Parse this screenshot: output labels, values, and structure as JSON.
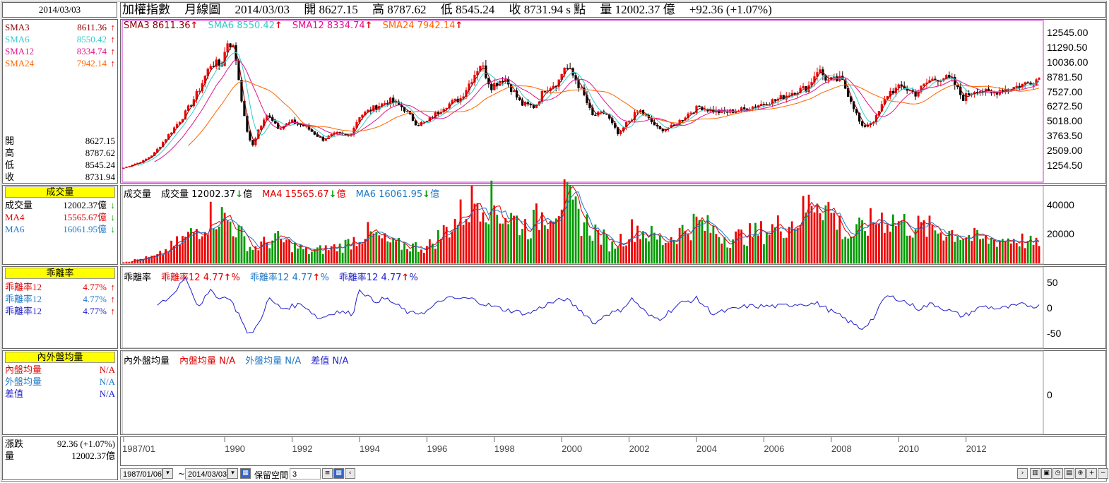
{
  "date_box": "2014/03/03",
  "header": {
    "index_name": "加權指數",
    "period": "月線圖",
    "date": "2014/03/03",
    "open": "開 8627.15",
    "high": "高 8787.62",
    "low": "低 8545.24",
    "close": "收 8731.94 s 點",
    "volume": "量 12002.37 億",
    "change": "+92.36 (+1.07%)"
  },
  "sma_panel": {
    "rows": [
      {
        "label": "SMA3",
        "value": "8611.36",
        "color": "#8b0000"
      },
      {
        "label": "SMA6",
        "value": "8550.42",
        "color": "#33cccc"
      },
      {
        "label": "SMA12",
        "value": "8334.74",
        "color": "#e0148c"
      },
      {
        "label": "SMA24",
        "value": "7942.14",
        "color": "#ff6600"
      }
    ],
    "arrow": "↑"
  },
  "ohlc_panel": {
    "rows": [
      {
        "label": "開",
        "value": "8627.15"
      },
      {
        "label": "高",
        "value": "8787.62"
      },
      {
        "label": "低",
        "value": "8545.24"
      },
      {
        "label": "收",
        "value": "8731.94"
      }
    ]
  },
  "volume_panel": {
    "title": "成交量",
    "rows": [
      {
        "label": "成交量",
        "value": "12002.37億",
        "color": "#000000",
        "arrow": "↓"
      },
      {
        "label": "MA4",
        "value": "15565.67億",
        "color": "#e00000",
        "arrow": "↓"
      },
      {
        "label": "MA6",
        "value": "16061.95億",
        "color": "#1e78c8",
        "arrow": "↓"
      }
    ]
  },
  "bias_panel": {
    "title": "乖離率",
    "rows": [
      {
        "label": "乖離率12",
        "value": "4.77%",
        "color": "#e00000",
        "arrow": "↑"
      },
      {
        "label": "乖離率12",
        "value": "4.77%",
        "color": "#1e78c8",
        "arrow": "↑"
      },
      {
        "label": "乖離率12",
        "value": "4.77%",
        "color": "#2020cc",
        "arrow": "↑"
      }
    ]
  },
  "inout_panel": {
    "title": "內外盤均量",
    "rows": [
      {
        "label": "內盤均量",
        "value": "N/A",
        "color": "#e00000"
      },
      {
        "label": "外盤均量",
        "value": "N/A",
        "color": "#1e78c8"
      },
      {
        "label": "差值",
        "value": "N/A",
        "color": "#2020cc"
      }
    ]
  },
  "change_panel": {
    "rows": [
      {
        "label": "漲跌",
        "value": "92.36 (+1.07%)"
      },
      {
        "label": "量",
        "value": "12002.37億"
      }
    ]
  },
  "legends": {
    "price": [
      {
        "text": "SMA3 8611.36",
        "color": "#8b0000"
      },
      {
        "text": "SMA6 8550.42",
        "color": "#33cccc"
      },
      {
        "text": "SMA12 8334.74",
        "color": "#e0148c"
      },
      {
        "text": "SMA24 7942.14",
        "color": "#ff6600"
      }
    ],
    "volume": [
      {
        "text": "成交量",
        "color": "#000000"
      },
      {
        "text": "成交量 12002.37",
        "color": "#000000",
        "suffix": "↓億"
      },
      {
        "text": "MA4 15565.67",
        "color": "#e00000",
        "suffix": "↓億"
      },
      {
        "text": "MA6 16061.95",
        "color": "#1e78c8",
        "suffix": "↓億"
      }
    ],
    "bias": [
      {
        "text": "乖離率",
        "color": "#000000"
      },
      {
        "text": "乖離率12 4.77",
        "color": "#e00000",
        "suffix": "↑%"
      },
      {
        "text": "乖離率12 4.77",
        "color": "#1e78c8",
        "suffix": "↑%"
      },
      {
        "text": "乖離率12 4.77",
        "color": "#2020cc",
        "suffix": "↑%"
      }
    ],
    "inout": [
      {
        "text": "內外盤均量",
        "color": "#000000"
      },
      {
        "text": "內盤均量 N/A",
        "color": "#e00000"
      },
      {
        "text": "外盤均量 N/A",
        "color": "#1e78c8"
      },
      {
        "text": "差值 N/A",
        "color": "#2020cc"
      }
    ]
  },
  "bottom_bar": {
    "start_date": "1987/01/06",
    "tilde": "~",
    "end_date": "2014/03/03",
    "reserve_label": "保留空間",
    "reserve_value": "3"
  },
  "chart_data": [
    {
      "type": "candlestick",
      "title": "加權指數 月線圖",
      "y_ticks": [
        12545.0,
        11290.5,
        10036.0,
        8781.5,
        7527.0,
        6272.5,
        5018.0,
        3763.5,
        2509.0,
        1254.5
      ],
      "ylim": [
        0,
        13500
      ],
      "x_ticks": [
        "1987/01",
        "1990",
        "1992",
        "1994",
        "1996",
        "1998",
        "2000",
        "2002",
        "2004",
        "2006",
        "2008",
        "2010",
        "2012"
      ],
      "x_range": [
        "1987/01",
        "2014/03"
      ],
      "close_anchors": [
        [
          1987.0,
          1100
        ],
        [
          1987.6,
          1700
        ],
        [
          1987.9,
          2300
        ],
        [
          1988.5,
          4500
        ],
        [
          1988.8,
          5600
        ],
        [
          1989.2,
          7500
        ],
        [
          1989.6,
          10000
        ],
        [
          1989.9,
          9800
        ],
        [
          1990.1,
          12000
        ],
        [
          1990.3,
          11000
        ],
        [
          1990.6,
          5000
        ],
        [
          1990.8,
          2800
        ],
        [
          1991.0,
          4300
        ],
        [
          1991.3,
          5700
        ],
        [
          1991.6,
          4500
        ],
        [
          1992.0,
          5000
        ],
        [
          1992.4,
          4600
        ],
        [
          1992.9,
          3500
        ],
        [
          1993.3,
          4000
        ],
        [
          1993.7,
          3800
        ],
        [
          1994.0,
          5500
        ],
        [
          1994.5,
          6300
        ],
        [
          1994.9,
          6800
        ],
        [
          1995.3,
          6200
        ],
        [
          1995.7,
          4800
        ],
        [
          1996.0,
          5000
        ],
        [
          1996.5,
          6300
        ],
        [
          1997.0,
          7000
        ],
        [
          1997.6,
          10000
        ],
        [
          1997.9,
          8000
        ],
        [
          1998.3,
          8800
        ],
        [
          1998.8,
          6500
        ],
        [
          1999.2,
          6300
        ],
        [
          1999.5,
          7800
        ],
        [
          1999.9,
          8400
        ],
        [
          2000.1,
          9800
        ],
        [
          2000.4,
          8700
        ],
        [
          2000.7,
          7000
        ],
        [
          2000.9,
          5500
        ],
        [
          2001.3,
          5800
        ],
        [
          2001.7,
          3800
        ],
        [
          2001.9,
          4800
        ],
        [
          2002.3,
          6000
        ],
        [
          2002.7,
          4900
        ],
        [
          2002.9,
          4300
        ],
        [
          2003.3,
          4600
        ],
        [
          2003.8,
          5800
        ],
        [
          2004.1,
          6300
        ],
        [
          2004.4,
          6000
        ],
        [
          2004.8,
          5800
        ],
        [
          2005.3,
          6000
        ],
        [
          2005.9,
          6500
        ],
        [
          2006.4,
          6900
        ],
        [
          2006.9,
          7600
        ],
        [
          2007.3,
          7900
        ],
        [
          2007.6,
          9500
        ],
        [
          2007.9,
          8500
        ],
        [
          2008.3,
          8600
        ],
        [
          2008.6,
          6800
        ],
        [
          2008.9,
          4500
        ],
        [
          2009.3,
          5200
        ],
        [
          2009.7,
          7500
        ],
        [
          2010.1,
          8000
        ],
        [
          2010.5,
          7400
        ],
        [
          2010.9,
          8500
        ],
        [
          2011.3,
          8800
        ],
        [
          2011.6,
          8500
        ],
        [
          2011.9,
          7000
        ],
        [
          2012.3,
          7800
        ],
        [
          2012.7,
          7400
        ],
        [
          2013.0,
          7700
        ],
        [
          2013.5,
          8000
        ],
        [
          2014.0,
          8500
        ],
        [
          2014.17,
          8731.94
        ]
      ],
      "series": [
        {
          "name": "SMA3",
          "last": 8611.36
        },
        {
          "name": "SMA6",
          "last": 8550.42
        },
        {
          "name": "SMA12",
          "last": 8334.74
        },
        {
          "name": "SMA24",
          "last": 7942.14
        }
      ]
    },
    {
      "type": "bar",
      "title": "成交量",
      "y_ticks": [
        40000,
        20000
      ],
      "ylim": [
        0,
        52000
      ],
      "volume_anchors": [
        [
          1987.0,
          1000
        ],
        [
          1988.0,
          5000
        ],
        [
          1989.0,
          20000
        ],
        [
          1989.7,
          35000
        ],
        [
          1990.2,
          28000
        ],
        [
          1990.8,
          10000
        ],
        [
          1991.5,
          17000
        ],
        [
          1992.5,
          8000
        ],
        [
          1993.5,
          12000
        ],
        [
          1994.2,
          21000
        ],
        [
          1995.0,
          13000
        ],
        [
          1996.0,
          11000
        ],
        [
          1996.8,
          28000
        ],
        [
          1997.6,
          48000
        ],
        [
          1998.2,
          35000
        ],
        [
          1999.0,
          25000
        ],
        [
          2000.0,
          45000
        ],
        [
          2000.6,
          30000
        ],
        [
          2001.5,
          12000
        ],
        [
          2002.2,
          25000
        ],
        [
          2003.0,
          15000
        ],
        [
          2004.0,
          28000
        ],
        [
          2005.0,
          17000
        ],
        [
          2006.0,
          22000
        ],
        [
          2007.0,
          30000
        ],
        [
          2007.6,
          48000
        ],
        [
          2008.5,
          18000
        ],
        [
          2009.5,
          32000
        ],
        [
          2010.5,
          25000
        ],
        [
          2011.5,
          22000
        ],
        [
          2012.5,
          16000
        ],
        [
          2013.5,
          17000
        ],
        [
          2014.17,
          12002.37
        ]
      ],
      "series": [
        {
          "name": "MA4",
          "last": 15565.67
        },
        {
          "name": "MA6",
          "last": 16061.95
        }
      ]
    },
    {
      "type": "line",
      "title": "乖離率",
      "y_ticks": [
        50,
        0,
        -50
      ],
      "ylim": [
        -75,
        80
      ],
      "bias_anchors": [
        [
          1988.0,
          5
        ],
        [
          1988.5,
          30
        ],
        [
          1988.8,
          65
        ],
        [
          1989.0,
          40
        ],
        [
          1989.2,
          5
        ],
        [
          1989.6,
          35
        ],
        [
          1989.9,
          20
        ],
        [
          1990.1,
          25
        ],
        [
          1990.5,
          -20
        ],
        [
          1990.7,
          -55
        ],
        [
          1991.0,
          -30
        ],
        [
          1991.3,
          20
        ],
        [
          1991.7,
          0
        ],
        [
          1992.3,
          10
        ],
        [
          1992.8,
          -20
        ],
        [
          1993.3,
          -5
        ],
        [
          1993.8,
          -10
        ],
        [
          1994.0,
          40
        ],
        [
          1994.4,
          15
        ],
        [
          1994.8,
          20
        ],
        [
          1995.5,
          -10
        ],
        [
          1996.0,
          -5
        ],
        [
          1996.5,
          20
        ],
        [
          1997.3,
          20
        ],
        [
          1997.7,
          10
        ],
        [
          1998.2,
          0
        ],
        [
          1999.0,
          -10
        ],
        [
          1999.6,
          10
        ],
        [
          2000.1,
          20
        ],
        [
          2000.6,
          -5
        ],
        [
          2001.0,
          -30
        ],
        [
          2001.3,
          -10
        ],
        [
          2001.7,
          -5
        ],
        [
          2002.1,
          20
        ],
        [
          2002.6,
          -15
        ],
        [
          2002.9,
          -20
        ],
        [
          2003.5,
          10
        ],
        [
          2004.0,
          20
        ],
        [
          2004.5,
          -10
        ],
        [
          2005.5,
          5
        ],
        [
          2006.5,
          5
        ],
        [
          2007.0,
          10
        ],
        [
          2007.6,
          10
        ],
        [
          2008.4,
          -20
        ],
        [
          2008.9,
          -40
        ],
        [
          2009.3,
          -15
        ],
        [
          2009.6,
          25
        ],
        [
          2010.0,
          20
        ],
        [
          2010.6,
          0
        ],
        [
          2011.0,
          10
        ],
        [
          2011.9,
          -15
        ],
        [
          2012.5,
          5
        ],
        [
          2013.0,
          0
        ],
        [
          2013.7,
          8
        ],
        [
          2014.17,
          4.77
        ]
      ]
    },
    {
      "type": "line",
      "title": "內外盤均量",
      "y_ticks": [
        0
      ],
      "values": []
    }
  ]
}
